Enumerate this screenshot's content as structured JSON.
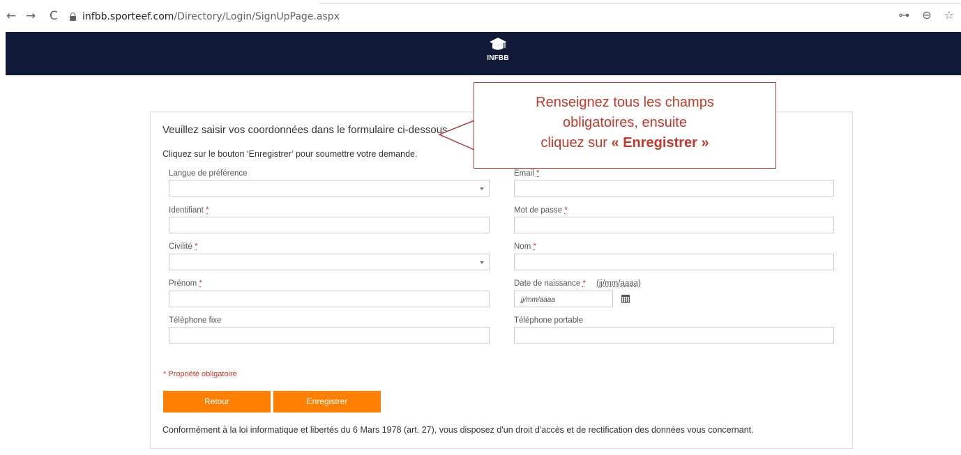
{
  "browser": {
    "back": "←",
    "forward": "→",
    "reload": "C",
    "url_host": "infbb.sporteef.com",
    "url_path": "/Directory/Login/SignUpPage.aspx",
    "icons": [
      "key-icon",
      "zoom-icon",
      "star-icon"
    ]
  },
  "header": {
    "logo_text": "INFBB",
    "background": "#121a3a"
  },
  "form": {
    "intro": "Veuillez saisir vos coordonnées dans le formulaire ci-dessous.",
    "sub": "Cliquez sur le bouton ‘Enregistrer’ pour soumettre votre demande.",
    "required_marker": "*",
    "fields": {
      "langue": {
        "label": "Langue de préférence",
        "value": ""
      },
      "email": {
        "label": "Email",
        "value": ""
      },
      "identifiant": {
        "label": "Identifiant",
        "value": ""
      },
      "mot_de_passe": {
        "label": "Mot de passe",
        "value": ""
      },
      "civilite": {
        "label": "Civilité",
        "value": ""
      },
      "nom": {
        "label": "Nom",
        "value": ""
      },
      "prenom": {
        "label": "Prénom",
        "value": ""
      },
      "date_naissance": {
        "label": "Date de naissance",
        "hint": "(jj/mm/aaaa)",
        "placeholder": "jj/mm/aaaa"
      },
      "tel_fixe": {
        "label": "Téléphone fixe",
        "value": ""
      },
      "tel_portable": {
        "label": "Téléphone portable",
        "value": ""
      }
    },
    "required_note": "* Propriété obligatoire",
    "buttons": {
      "retour": "Retour",
      "enregistrer": "Enregistrer"
    },
    "legal": "Conformément à la loi informatique et libertés du 6 Mars 1978 (art. 27), vous disposez d'un droit d'accès et de rectification des données vous concernant."
  },
  "callout": {
    "line1": "Renseignez tous les champs",
    "line2": "obligatoires, ensuite",
    "line3_prefix": "cliquez sur ",
    "line3_bold": "« Enregistrer »"
  },
  "colors": {
    "accent": "#ff7f00",
    "required": "#c0392b",
    "callout_border": "#b03a3a"
  }
}
